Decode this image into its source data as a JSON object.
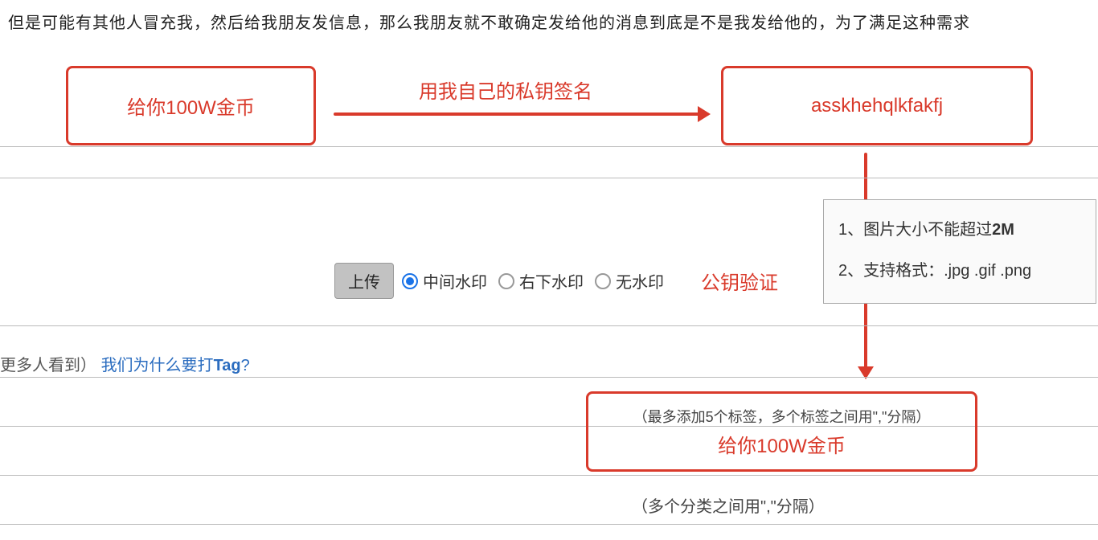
{
  "intro_text": "但是可能有其他人冒充我，然后给我朋友发信息，那么我朋友就不敢确定发给他的消息到底是不是我发给他的，为了满足这种需求",
  "diagram": {
    "message_box": "给你100W金币",
    "signature_box": "asskhehqlkfakfj",
    "result_box_sub": "（最多添加5个标签，多个标签之间用\",\"分隔）",
    "result_box_main": "给你100W金币",
    "arrow_sign_label": "用我自己的私钥签名",
    "arrow_verify_label": "公钥验证"
  },
  "upload": {
    "button_label": "上传",
    "options": [
      {
        "label": "中间水印",
        "selected": true
      },
      {
        "label": "右下水印",
        "selected": false
      },
      {
        "label": "无水印",
        "selected": false
      }
    ]
  },
  "info_box": {
    "line1_prefix": "1、图片大小不能超过",
    "line1_bold": "2M",
    "line2": "2、支持格式：.jpg .gif .png"
  },
  "tag_section": {
    "prefix": "更多人看到）",
    "link_prefix": "我们为什么要打",
    "link_bold": "Tag",
    "link_suffix": "?"
  },
  "category_hint": "（多个分类之间用\",\"分隔）"
}
